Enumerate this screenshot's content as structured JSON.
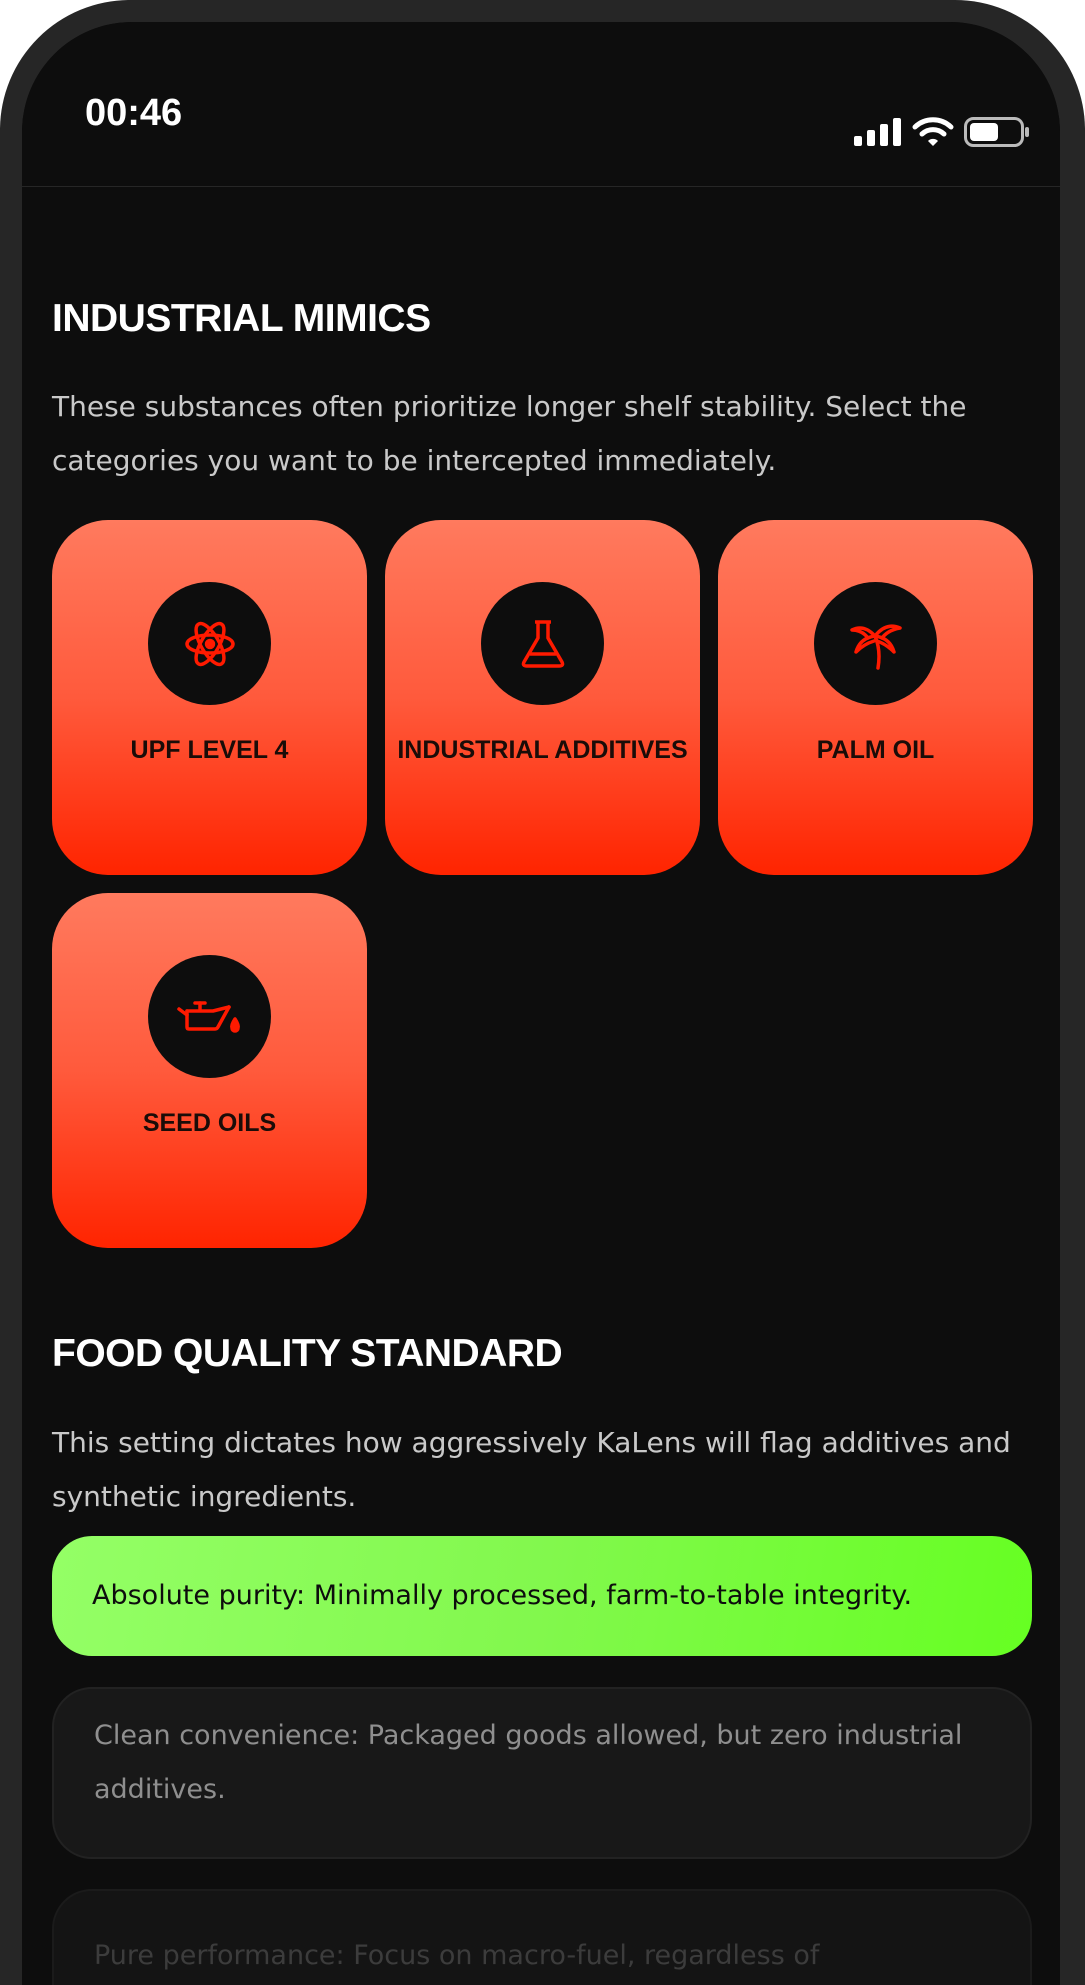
{
  "status_bar": {
    "time": "00:46",
    "icons": [
      "signal-icon",
      "wifi-icon",
      "battery-icon"
    ]
  },
  "industrial_mimics": {
    "title": "INDUSTRIAL MIMICS",
    "description": "These substances often prioritize longer shelf stability. Select the categories you want to be intercepted immediately.",
    "tiles": [
      {
        "label": "UPF LEVEL 4",
        "icon": "atom-icon"
      },
      {
        "label": "INDUSTRIAL ADDITIVES",
        "icon": "flask-icon"
      },
      {
        "label": "PALM OIL",
        "icon": "palm-tree-icon"
      },
      {
        "label": "SEED OILS",
        "icon": "oil-can-icon"
      }
    ]
  },
  "food_quality": {
    "title": "FOOD QUALITY STANDARD",
    "description": "This setting dictates how aggressively KaLens will flag additives and synthetic ingredients.",
    "options": [
      {
        "label": "Absolute purity: Minimally processed, farm-to-table integrity.",
        "selected": true
      },
      {
        "label": "Clean convenience: Packaged goods allowed, but zero industrial additives.",
        "selected": false
      },
      {
        "label": "Pure performance: Focus on macro-fuel, regardless of",
        "selected": false
      }
    ]
  },
  "colors": {
    "background": "#0d0d0d",
    "tile_gradient_top": "#ff7a5e",
    "tile_gradient_bottom": "#ff2400",
    "icon_accent": "#ff1a00",
    "selected_option": "#82f84d"
  }
}
